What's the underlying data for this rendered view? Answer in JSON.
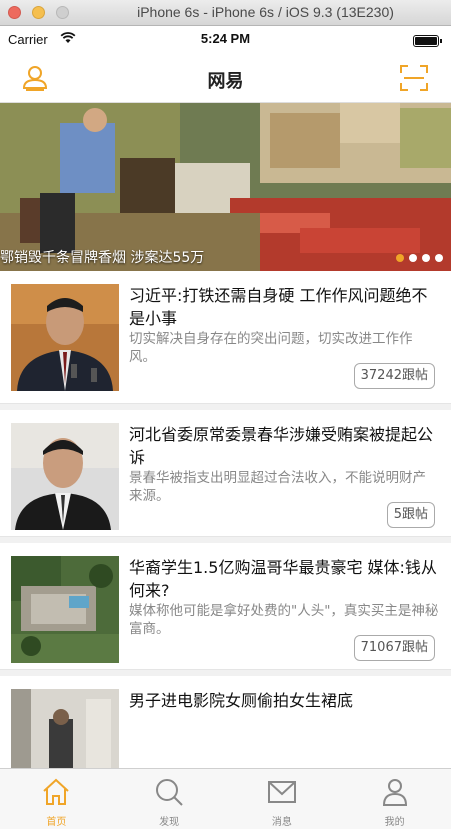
{
  "window": {
    "title": "iPhone 6s - iPhone 6s / iOS 9.3 (13E230)"
  },
  "status_bar": {
    "carrier": "Carrier",
    "time": "5:24 PM"
  },
  "nav": {
    "title": "网易",
    "left_icon": "user-icon",
    "right_icon": "scan-icon"
  },
  "colors": {
    "accent": "#f0a528"
  },
  "banner": {
    "caption": "鄂销毁千条冒牌香烟 涉案达55万",
    "page_count": 4,
    "active_page": 0
  },
  "news": [
    {
      "title": "习近平:打铁还需自身硬 工作作风问题绝不是小事",
      "desc": "切实解决自身存在的突出问题，切实改进工作作风。",
      "replies": "37242跟帖"
    },
    {
      "title": "河北省委原常委景春华涉嫌受贿案被提起公诉",
      "desc": "景春华被指支出明显超过合法收入，不能说明财产来源。",
      "replies": "5跟帖"
    },
    {
      "title": "华裔学生1.5亿购温哥华最贵豪宅 媒体:钱从何来?",
      "desc": "媒体称他可能是拿好处费的\"人头\"，真实买主是神秘富商。",
      "replies": "71067跟帖"
    },
    {
      "title": "男子进电影院女厕偷拍女生裙底",
      "desc": "",
      "replies": ""
    }
  ],
  "tabs": [
    {
      "label": "首页",
      "icon": "home-icon",
      "active": true
    },
    {
      "label": "发现",
      "icon": "search-icon",
      "active": false
    },
    {
      "label": "消息",
      "icon": "mail-icon",
      "active": false
    },
    {
      "label": "我的",
      "icon": "profile-icon",
      "active": false
    }
  ]
}
